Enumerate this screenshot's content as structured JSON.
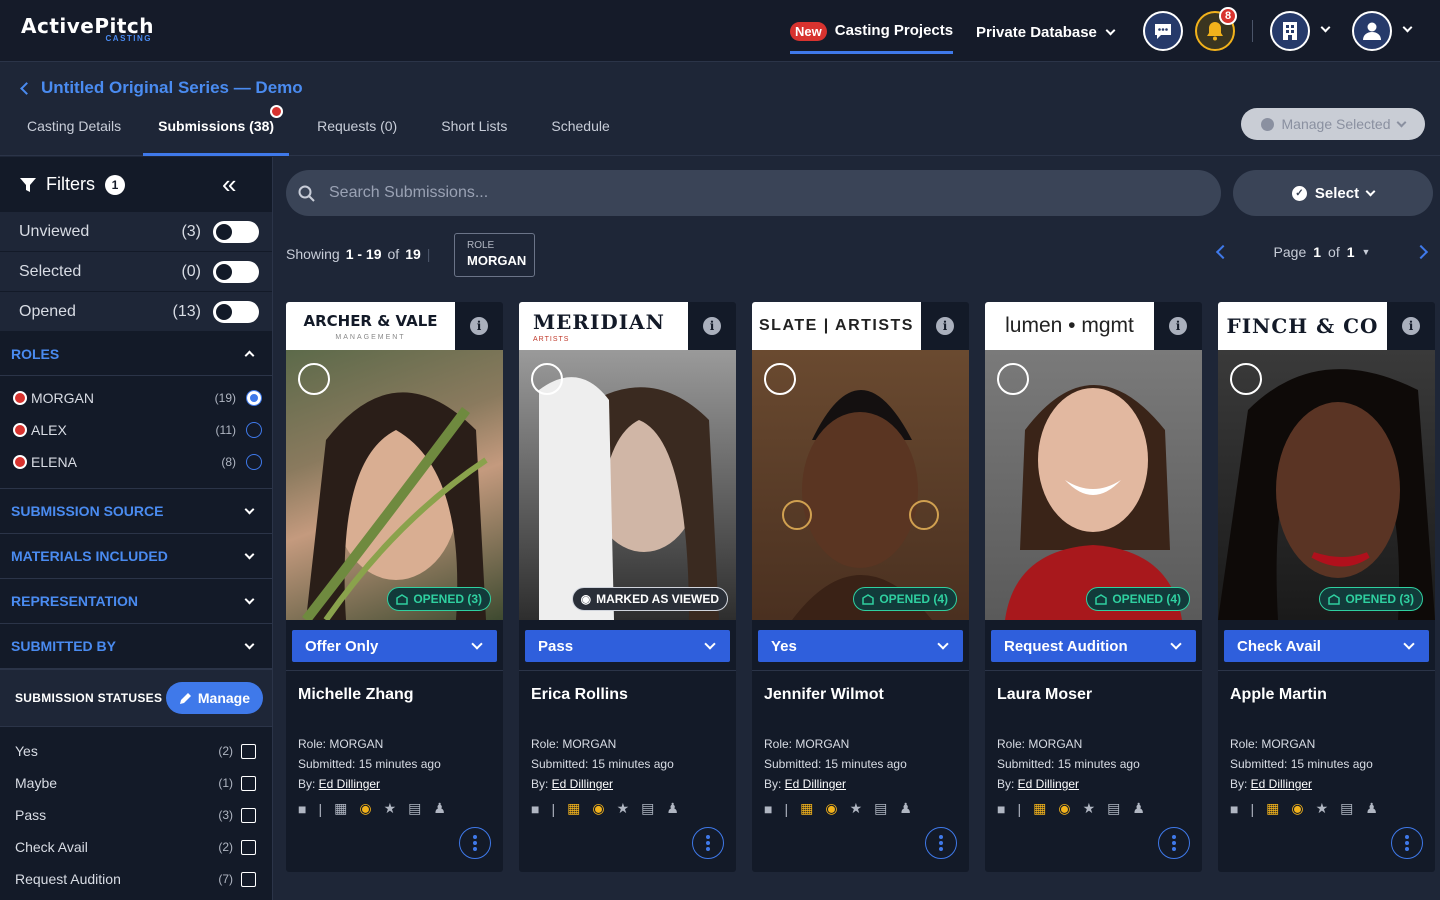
{
  "app": {
    "logo_main": "ActivePitch",
    "logo_sub": "CASTING"
  },
  "topnav": {
    "new_badge": "New",
    "casting_projects": "Casting Projects",
    "private_database": "Private Database",
    "notification_count": "8"
  },
  "header": {
    "breadcrumb": "Untitled Original Series — Demo",
    "manage_selected": "Manage Selected"
  },
  "tabs": [
    {
      "label": "Casting Details"
    },
    {
      "label": "Submissions (38)"
    },
    {
      "label": "Requests (0)"
    },
    {
      "label": "Short Lists"
    },
    {
      "label": "Schedule"
    }
  ],
  "sidebar": {
    "filters_label": "Filters",
    "filters_count": "1",
    "toggles": [
      {
        "label": "Unviewed",
        "count": "(3)"
      },
      {
        "label": "Selected",
        "count": "(0)"
      },
      {
        "label": "Opened",
        "count": "(13)"
      }
    ],
    "roles_heading": "ROLES",
    "roles": [
      {
        "label": "MORGAN",
        "count": "(19)"
      },
      {
        "label": "ALEX",
        "count": "(11)"
      },
      {
        "label": "ELENA",
        "count": "(8)"
      }
    ],
    "sections": [
      "SUBMISSION SOURCE",
      "MATERIALS INCLUDED",
      "REPRESENTATION",
      "SUBMITTED BY"
    ],
    "statuses_heading": "SUBMISSION STATUSES",
    "manage_label": "Manage",
    "statuses": [
      {
        "label": "Yes",
        "count": "(2)"
      },
      {
        "label": "Maybe",
        "count": "(1)"
      },
      {
        "label": "Pass",
        "count": "(3)"
      },
      {
        "label": "Check Avail",
        "count": "(2)"
      },
      {
        "label": "Request Audition",
        "count": "(7)"
      }
    ]
  },
  "search": {
    "placeholder": "Search Submissions..."
  },
  "select_label": "Select",
  "results": {
    "showing": "Showing",
    "range": "1 - 19",
    "of": "of",
    "total": "19",
    "role_key": "ROLE",
    "role_value": "MORGAN"
  },
  "pager": {
    "page_label": "Page",
    "page": "1",
    "of": "of",
    "pages": "1"
  },
  "cards": [
    {
      "agency": "ARCHER & VALE",
      "agency_sub": "MANAGEMENT",
      "badge": "OPENED (3)",
      "status": "Offer Only",
      "name": "Michelle Zhang",
      "role": "Role: MORGAN",
      "submitted": "Submitted: 15 minutes ago",
      "by_prefix": "By: ",
      "by": "Ed Dillinger"
    },
    {
      "agency": "MERIDIAN",
      "agency_sub": "ARTISTS",
      "badge": "MARKED AS VIEWED",
      "status": "Pass",
      "name": "Erica Rollins",
      "role": "Role: MORGAN",
      "submitted": "Submitted: 15 minutes ago",
      "by_prefix": "By: ",
      "by": "Ed Dillinger"
    },
    {
      "agency": "SLATE | ARTISTS",
      "agency_sub": "",
      "badge": "OPENED (4)",
      "status": "Yes",
      "name": "Jennifer Wilmot",
      "role": "Role: MORGAN",
      "submitted": "Submitted: 15 minutes ago",
      "by_prefix": "By: ",
      "by": "Ed Dillinger"
    },
    {
      "agency": "lumen • mgmt",
      "agency_sub": "",
      "badge": "OPENED (4)",
      "status": "Request Audition",
      "name": "Laura Moser",
      "role": "Role: MORGAN",
      "submitted": "Submitted: 15 minutes ago",
      "by_prefix": "By: ",
      "by": "Ed Dillinger"
    },
    {
      "agency": "FINCH & CO",
      "agency_sub": "",
      "badge": "OPENED (3)",
      "status": "Check Avail",
      "name": "Apple Martin",
      "role": "Role: MORGAN",
      "submitted": "Submitted: 15 minutes ago",
      "by_prefix": "By: ",
      "by": "Ed Dillinger"
    }
  ],
  "colors": {
    "accent": "#3f79ea",
    "alert": "#d8332f",
    "opened": "#2fd0a0",
    "materials_present": "#f2b21b"
  }
}
